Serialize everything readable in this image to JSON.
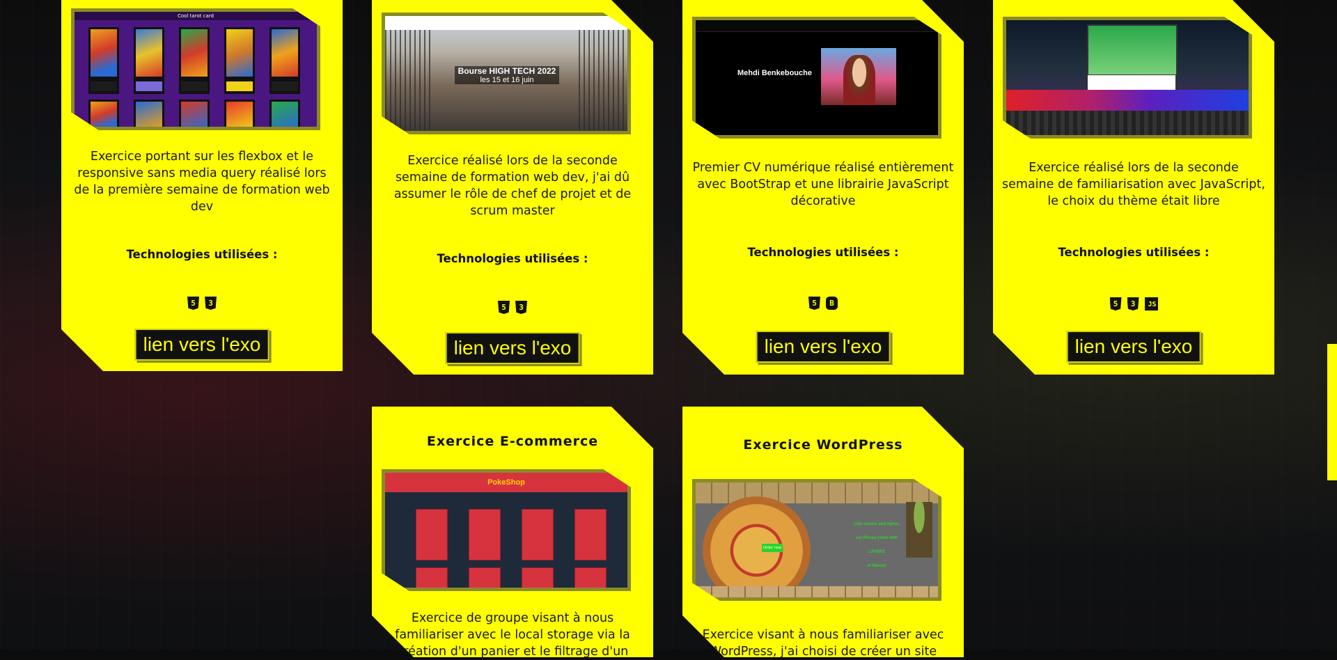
{
  "cards": [
    {
      "screenshot_label": "Cool tarot card",
      "description": "Exercice portant sur les flexbox et le responsive sans media query réalisé lors de la première semaine de formation web dev",
      "tech_title": "Technologies utilisées :",
      "techs": [
        "html5-icon",
        "css3-icon"
      ],
      "link_label": "lien vers l'exo"
    },
    {
      "screenshot_title": "Bourse HIGH TECH 2022",
      "screenshot_subtitle": "les 15 et 16 juin",
      "description": "Exercice réalisé lors de la seconde semaine de formation web dev, j'ai dû assumer le rôle de chef de projet et de scrum master",
      "tech_title": "Technologies utilisées :",
      "techs": [
        "html5-icon",
        "css3-icon"
      ],
      "link_label": "lien vers l'exo"
    },
    {
      "screenshot_name": "Mehdi Benkebouche",
      "description": "Premier CV numérique réalisé entièrement avec BootStrap et une librairie JavaScript décorative",
      "tech_title": "Technologies utilisées :",
      "techs": [
        "html5-icon",
        "bootstrap-icon"
      ],
      "link_label": "lien vers l'exo"
    },
    {
      "description": "Exercice réalisé lors de la seconde semaine de familiarisation avec JavaScript, le choix du thème était libre",
      "tech_title": "Technologies utilisées :",
      "techs": [
        "html5-icon",
        "css3-icon",
        "javascript-icon"
      ],
      "link_label": "lien vers l'exo"
    },
    {
      "title": "Exercice E-commerce",
      "screenshot_brand": "PokeShop",
      "description": "Exercice de groupe visant à nous familiariser avec le local storage via la création d'un panier et le filtrage d'un"
    },
    {
      "title": "Exercice WordPress",
      "screenshot_lines": [
        "Like onions and ogres,",
        "our Pizzas come with",
        "LAYERS",
        "of flavour"
      ],
      "screenshot_button": "Order now",
      "description": "Exercice visant à nous familiariser avec WordPress, j'ai choisi de créer un site"
    }
  ],
  "icon_glyphs": {
    "html5": "5",
    "css3": "3",
    "bootstrap": "B",
    "javascript": "JS"
  },
  "colors": {
    "accent": "#ffff00",
    "background": "#111214",
    "text": "#111111"
  }
}
